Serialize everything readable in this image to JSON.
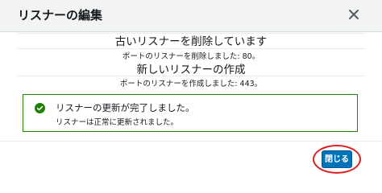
{
  "dialog": {
    "title": "リスナーの編集",
    "close_icon": "close-icon"
  },
  "delete_section": {
    "heading": "古いリスナーを削除しています",
    "detail": "ポートのリスナーを削除しました: 80。"
  },
  "create_section": {
    "heading": "新しいリスナーの作成",
    "detail": "ポートのリスナーを作成しました: 443。"
  },
  "alert": {
    "icon": "check-circle-icon",
    "title": "リスナーの更新が完了しました。",
    "message": "リスナーは正常に更新されました。",
    "color": "#1d8102"
  },
  "footer": {
    "close_button_label": "閉じる",
    "accent_color": "#0073bb",
    "highlight_color": "#e02020"
  }
}
